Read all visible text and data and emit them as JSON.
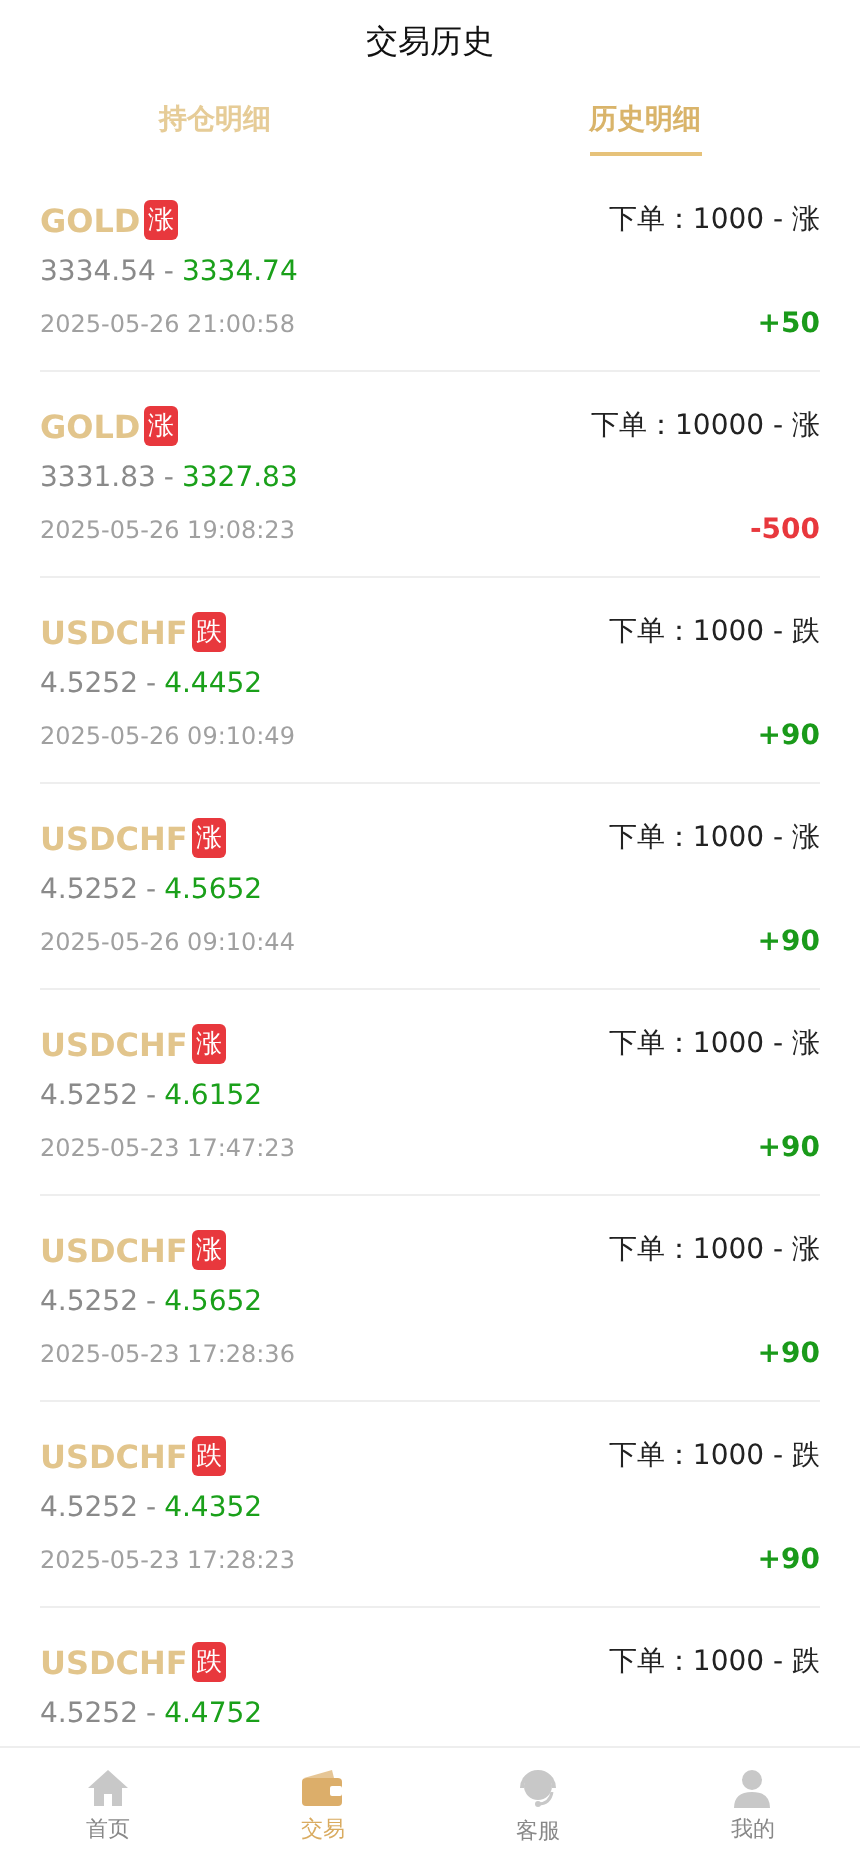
{
  "title": "交易历史",
  "tabs": [
    {
      "label": "持仓明细",
      "selected": false
    },
    {
      "label": "历史明细",
      "selected": true
    }
  ],
  "trades": [
    {
      "symbol": "GOLD",
      "direction": "涨",
      "order": "下单：1000 - 涨",
      "open": "3334.54",
      "separator": "-",
      "close": "3334.74",
      "time": "2025-05-26 21:00:58",
      "profit": "+50",
      "kind": "gain"
    },
    {
      "symbol": "GOLD",
      "direction": "涨",
      "order": "下单：10000 - 涨",
      "open": "3331.83",
      "separator": "-",
      "close": "3327.83",
      "time": "2025-05-26 19:08:23",
      "profit": "-500",
      "kind": "loss"
    },
    {
      "symbol": "USDCHF",
      "direction": "跌",
      "order": "下单：1000 - 跌",
      "open": "4.5252",
      "separator": "-",
      "close": "4.4452",
      "time": "2025-05-26 09:10:49",
      "profit": "+90",
      "kind": "gain"
    },
    {
      "symbol": "USDCHF",
      "direction": "涨",
      "order": "下单：1000 - 涨",
      "open": "4.5252",
      "separator": "-",
      "close": "4.5652",
      "time": "2025-05-26 09:10:44",
      "profit": "+90",
      "kind": "gain"
    },
    {
      "symbol": "USDCHF",
      "direction": "涨",
      "order": "下单：1000 - 涨",
      "open": "4.5252",
      "separator": "-",
      "close": "4.6152",
      "time": "2025-05-23 17:47:23",
      "profit": "+90",
      "kind": "gain"
    },
    {
      "symbol": "USDCHF",
      "direction": "涨",
      "order": "下单：1000 - 涨",
      "open": "4.5252",
      "separator": "-",
      "close": "4.5652",
      "time": "2025-05-23 17:28:36",
      "profit": "+90",
      "kind": "gain"
    },
    {
      "symbol": "USDCHF",
      "direction": "跌",
      "order": "下单：1000 - 跌",
      "open": "4.5252",
      "separator": "-",
      "close": "4.4352",
      "time": "2025-05-23 17:28:23",
      "profit": "+90",
      "kind": "gain"
    },
    {
      "symbol": "USDCHF",
      "direction": "跌",
      "order": "下单：1000 - 跌",
      "open": "4.5252",
      "separator": "-",
      "close": "4.4752"
    }
  ],
  "nav": [
    {
      "label": "首页",
      "kind": "home",
      "selected": false
    },
    {
      "label": "交易",
      "kind": "wallet",
      "selected": true
    },
    {
      "label": "客服",
      "kind": "support",
      "selected": false
    },
    {
      "label": "我的",
      "kind": "user",
      "selected": false
    }
  ]
}
